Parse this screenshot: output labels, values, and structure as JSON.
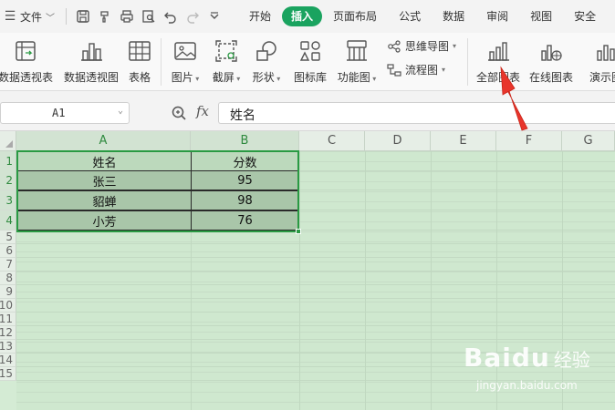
{
  "menubar": {
    "file_label": "文件",
    "tabs": [
      {
        "label": "开始",
        "active": false
      },
      {
        "label": "插入",
        "active": true
      },
      {
        "label": "页面布局",
        "active": false
      },
      {
        "label": "公式",
        "active": false
      },
      {
        "label": "数据",
        "active": false
      },
      {
        "label": "审阅",
        "active": false
      },
      {
        "label": "视图",
        "active": false
      },
      {
        "label": "安全",
        "active": false
      }
    ]
  },
  "ribbon": {
    "pivot_table": "数据透视表",
    "pivot_chart": "数据透视图",
    "table": "表格",
    "picture": "图片",
    "screenshot": "截屏",
    "shapes": "形状",
    "icon_library": "图标库",
    "function_chart": "功能图",
    "mind_map": "思维导图",
    "flowchart": "流程图",
    "all_charts": "全部图表",
    "online_charts": "在线图表",
    "demo_chart": "演示图"
  },
  "formula_bar": {
    "cell_ref": "A1",
    "fx_label": "fx",
    "content": "姓名"
  },
  "sheet": {
    "columns": [
      "A",
      "B",
      "C",
      "D",
      "E",
      "F",
      "G"
    ],
    "rows": [
      "1",
      "2",
      "3",
      "4",
      "5",
      "6",
      "7",
      "8",
      "9",
      "10",
      "11",
      "12",
      "13",
      "14",
      "15"
    ],
    "table": {
      "header": [
        "姓名",
        "分数"
      ],
      "rows": [
        [
          "张三",
          "95"
        ],
        [
          "貂蝉",
          "98"
        ],
        [
          "小芳",
          "76"
        ]
      ]
    }
  },
  "watermark": {
    "brand": "Baidu",
    "suffix": "经验",
    "url": "jingyan.baidu.com"
  },
  "colors": {
    "accent": "#1aa35f",
    "selection": "#2a9a43",
    "arrow": "#e8352c",
    "sheet_bg": "#cfe8cf"
  }
}
